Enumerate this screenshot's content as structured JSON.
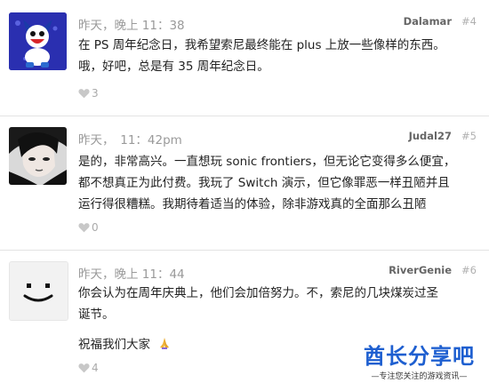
{
  "posts": [
    {
      "time": "昨天，晚上 11：38",
      "author": "Dalamar",
      "number": "#4",
      "lines": [
        "在 PS 周年纪念日，我希望索尼最终能在 plus 上放一些像样的东西。",
        "哦，好吧，总是有 35 周年纪念日。"
      ],
      "likes": "3",
      "avatar_icon": "jack-frost-avatar"
    },
    {
      "time": "昨天，　11：42pm",
      "author": "Judal27",
      "number": "#5",
      "lines": [
        "是的，非常高兴。一直想玩 sonic frontiers，但无论它变得多么便宜，",
        "都不想真正为此付费。我玩了 Switch 演示，但它像罪恶一样丑陋并且",
        "运行得很糟糕。我期待着适当的体验，除非游戏真的全面那么丑陋"
      ],
      "likes": "0",
      "avatar_icon": "anime-character-avatar"
    },
    {
      "time": "昨天，晚上 11：44",
      "author": "RiverGenie",
      "number": "#6",
      "lines": [
        "你会认为在周年庆典上，他们会加倍努力。不，索尼的几块煤炭过圣",
        "诞节。"
      ],
      "extra_line": "祝福我们大家",
      "likes": "4",
      "avatar_icon": "smiley-face-avatar"
    }
  ],
  "watermark": {
    "title": "酋长分享吧",
    "subtitle": "—专注您关注的游戏资讯—"
  },
  "colors": {
    "accent": "#1e5fd0",
    "divider": "#e3e3e3",
    "meta": "#9a9a9a"
  }
}
